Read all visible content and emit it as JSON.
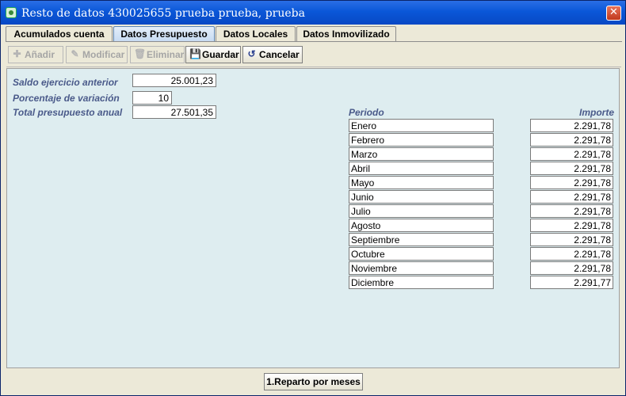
{
  "window": {
    "title": "Resto de datos 430025655 prueba prueba, prueba",
    "close_label": "✕"
  },
  "tabs": [
    {
      "label": "Acumulados cuenta",
      "active": false
    },
    {
      "label": "Datos Presupuesto",
      "active": true
    },
    {
      "label": "Datos Locales",
      "active": false
    },
    {
      "label": "Datos Inmovilizado",
      "active": false
    }
  ],
  "toolbar": {
    "add_label": "Añadir",
    "modify_label": "Modificar",
    "delete_label": "Eliminar",
    "save_label": "Guardar",
    "cancel_label": "Cancelar"
  },
  "form": {
    "saldo_label": "Saldo ejercicio anterior",
    "saldo_value": "25.001,23",
    "porcentaje_label": "Porcentaje de variación",
    "porcentaje_value": "10",
    "total_label": "Total presupuesto anual",
    "total_value": "27.501,35"
  },
  "table": {
    "periodo_header": "Periodo",
    "importe_header": "Importe",
    "rows": [
      {
        "periodo": "Enero",
        "importe": "2.291,78"
      },
      {
        "periodo": "Febrero",
        "importe": "2.291,78"
      },
      {
        "periodo": "Marzo",
        "importe": "2.291,78"
      },
      {
        "periodo": "Abril",
        "importe": "2.291,78"
      },
      {
        "periodo": "Mayo",
        "importe": "2.291,78"
      },
      {
        "periodo": "Junio",
        "importe": "2.291,78"
      },
      {
        "periodo": "Julio",
        "importe": "2.291,78"
      },
      {
        "periodo": "Agosto",
        "importe": "2.291,78"
      },
      {
        "periodo": "Septiembre",
        "importe": "2.291,78"
      },
      {
        "periodo": "Octubre",
        "importe": "2.291,78"
      },
      {
        "periodo": "Noviembre",
        "importe": "2.291,78"
      },
      {
        "periodo": "Diciembre",
        "importe": "2.291,77"
      }
    ]
  },
  "bottom": {
    "reparto_label": "1.Reparto por meses"
  }
}
